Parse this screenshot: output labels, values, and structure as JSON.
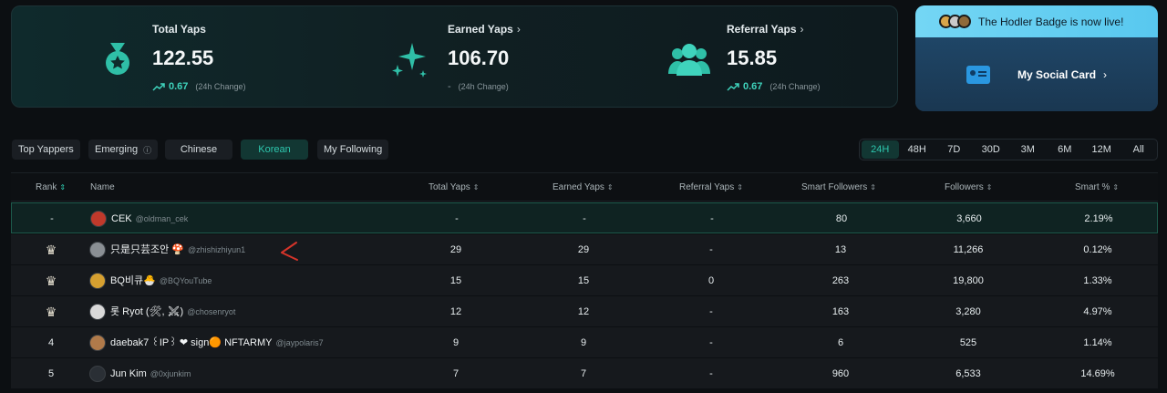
{
  "stats": {
    "total": {
      "label": "Total Yaps",
      "value": "122.55",
      "change": "0.67",
      "change_note": "(24h Change)"
    },
    "earned": {
      "label": "Earned Yaps",
      "value": "106.70",
      "change": "-",
      "change_note": "(24h Change)"
    },
    "referral": {
      "label": "Referral Yaps",
      "value": "15.85",
      "change": "0.67",
      "change_note": "(24h Change)"
    },
    "chevron": "›"
  },
  "badge_card": {
    "banner_text": "The Hodler Badge is now live!",
    "social_label": "My Social Card",
    "chevron": "›"
  },
  "filters": [
    {
      "label": "Top Yappers",
      "active": false
    },
    {
      "label": "Emerging",
      "active": false,
      "icon": "info-icon"
    },
    {
      "label": "Chinese",
      "active": false
    },
    {
      "label": "Korean",
      "active": true
    },
    {
      "label": "My Following",
      "active": false
    }
  ],
  "periods": [
    "24H",
    "48H",
    "7D",
    "30D",
    "3M",
    "6M",
    "12M",
    "All"
  ],
  "active_period": "24H",
  "columns": {
    "rank": "Rank",
    "name": "Name",
    "total": "Total Yaps",
    "earned": "Earned Yaps",
    "referral": "Referral Yaps",
    "smart_followers": "Smart Followers",
    "followers": "Followers",
    "smart_pct": "Smart %",
    "sort_glyph": "⇕"
  },
  "rows": [
    {
      "rank": "-",
      "name": "CEK",
      "handle": "@oldman_cek",
      "total": "-",
      "earned": "-",
      "referral": "-",
      "smart_followers": "80",
      "followers": "3,660",
      "smart_pct": "2.19%",
      "avatar_color": "#c0392b"
    },
    {
      "rank": "♛",
      "name": "只是只芸조안 🍄",
      "handle": "@zhishizhiyun1",
      "total": "29",
      "earned": "29",
      "referral": "-",
      "smart_followers": "13",
      "followers": "11,266",
      "smart_pct": "0.12%",
      "avatar_color": "#8a8f94"
    },
    {
      "rank": "♛",
      "name": "BQ비큐🐣",
      "handle": "@BQYouTube",
      "total": "15",
      "earned": "15",
      "referral": "0",
      "smart_followers": "263",
      "followers": "19,800",
      "smart_pct": "1.33%",
      "avatar_color": "#d6a030"
    },
    {
      "rank": "♛",
      "name": "롯 Ryot (🛠, ⚔)",
      "handle": "@chosenryot",
      "total": "12",
      "earned": "12",
      "referral": "-",
      "smart_followers": "163",
      "followers": "3,280",
      "smart_pct": "4.97%",
      "avatar_color": "#d9d9d9"
    },
    {
      "rank": "4",
      "name": "daebak7 ꒰IP꒱ ❤ sign🟠 NFTARMY",
      "handle": "@jaypolaris7",
      "total": "9",
      "earned": "9",
      "referral": "-",
      "smart_followers": "6",
      "followers": "525",
      "smart_pct": "1.14%",
      "avatar_color": "#b07a4a"
    },
    {
      "rank": "5",
      "name": "Jun Kim",
      "handle": "@0xjunkim",
      "total": "7",
      "earned": "7",
      "referral": "-",
      "smart_followers": "960",
      "followers": "6,533",
      "smart_pct": "14.69%",
      "avatar_color": "#2a2f35"
    }
  ]
}
